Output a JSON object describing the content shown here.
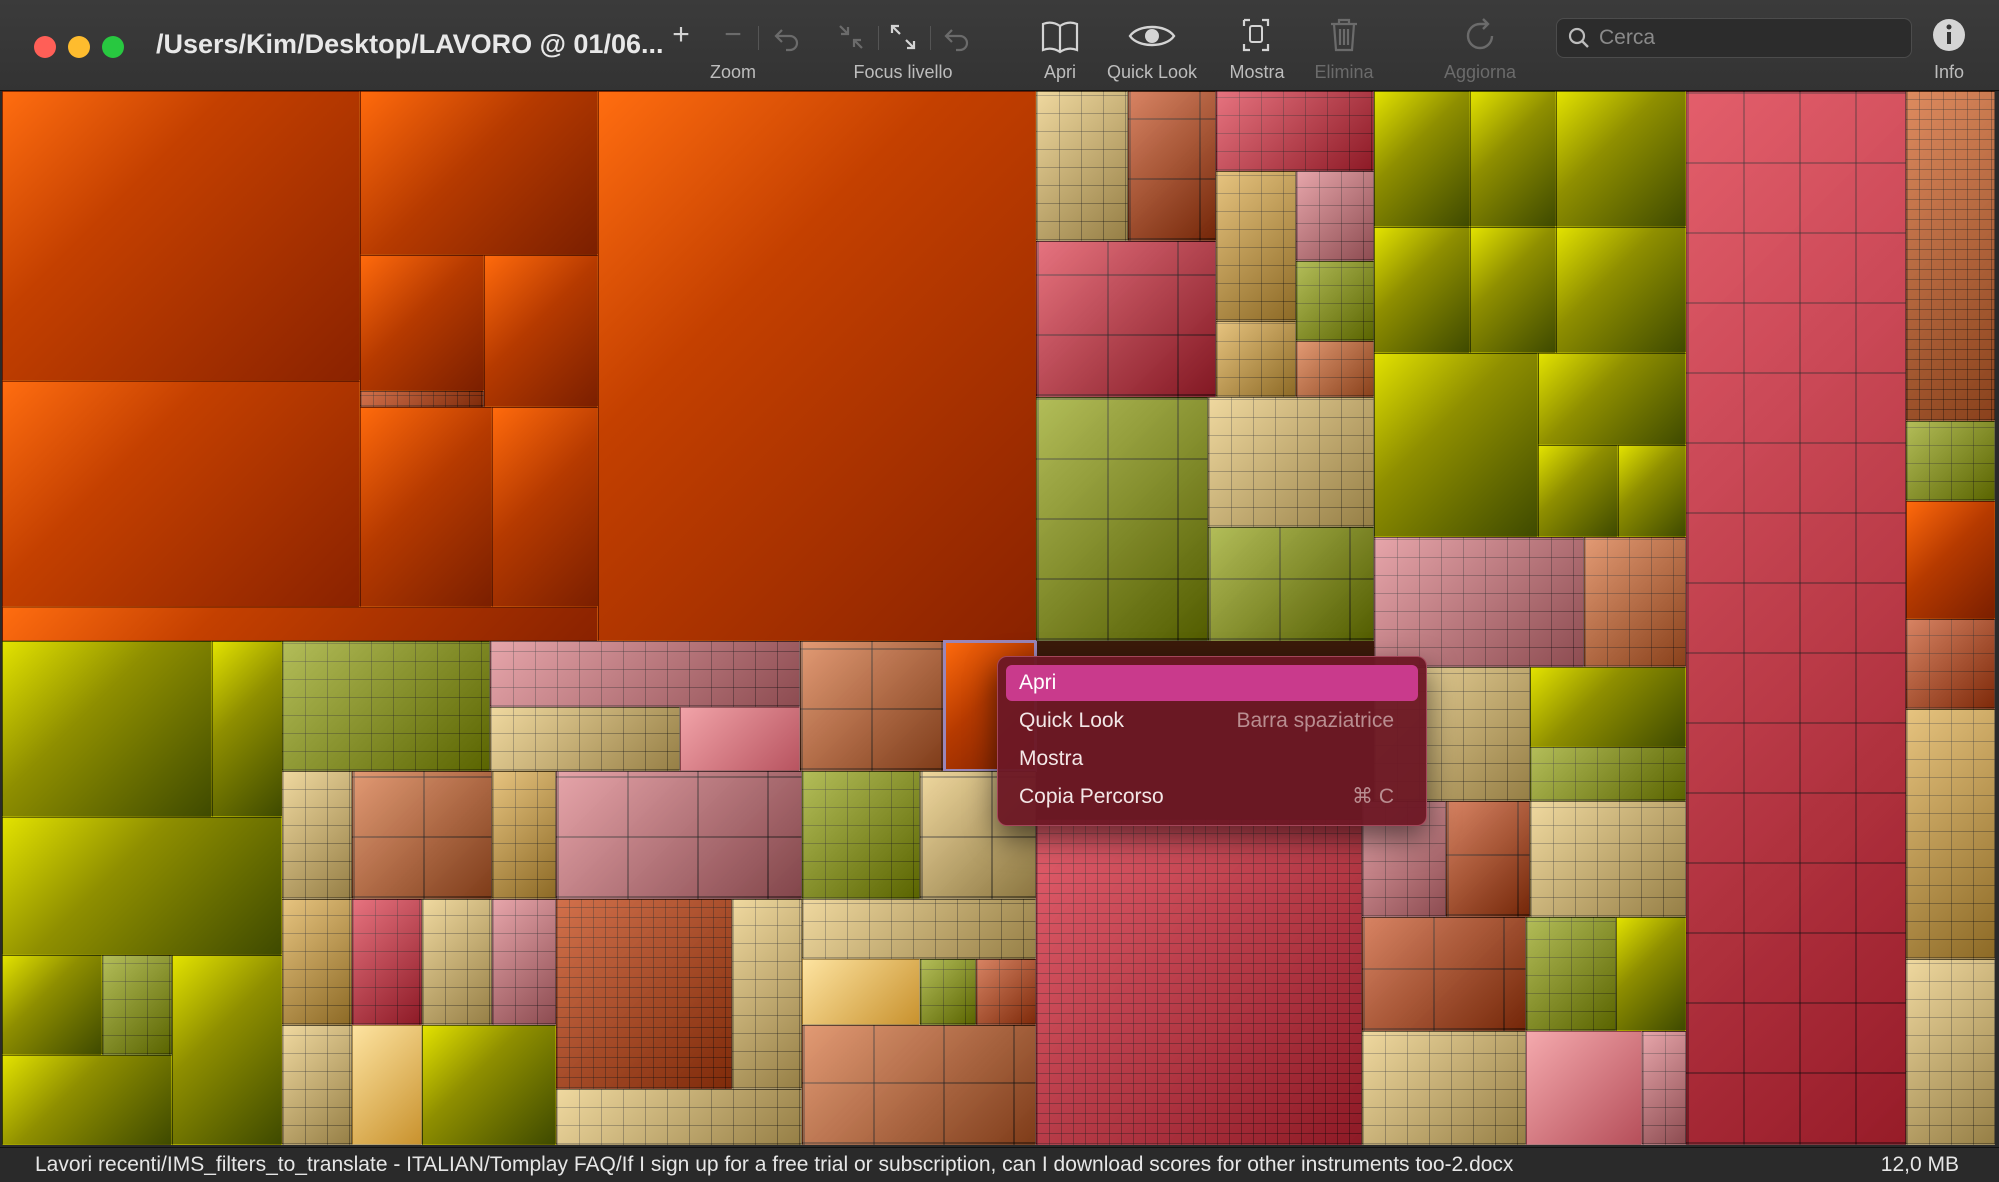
{
  "window": {
    "title": "/Users/Kim/Desktop/LAVORO @ 01/06..."
  },
  "toolbar": {
    "zoom_in_glyph": "+",
    "zoom_out_glyph": "−",
    "zoom_label": "Zoom",
    "focus_label": "Focus livello",
    "open_label": "Apri",
    "quicklook_label": "Quick Look",
    "reveal_label": "Mostra",
    "delete_label": "Elimina",
    "refresh_label": "Aggiorna",
    "info_label": "Info",
    "search_placeholder": "Cerca"
  },
  "icons": {
    "zoom_in": "plus-icon",
    "zoom_out": "minus-icon",
    "back": "undo-icon",
    "collapse": "collapse-arrows-icon",
    "expand": "expand-arrows-icon",
    "open": "book-icon",
    "quicklook": "eye-icon",
    "reveal": "reveal-icon",
    "delete": "trash-icon",
    "refresh": "refresh-icon",
    "search": "search-icon",
    "info": "info-icon"
  },
  "context_menu": {
    "items": [
      {
        "label": "Apri",
        "shortcut": ""
      },
      {
        "label": "Quick Look",
        "shortcut": "Barra spaziatrice"
      },
      {
        "label": "Mostra",
        "shortcut": ""
      },
      {
        "label": "Copia Percorso",
        "shortcut": "⌘ C"
      }
    ]
  },
  "statusbar": {
    "path": "Lavori recenti/IMS_filters_to_translate - ITALIAN/Tomplay FAQ/If I sign up for a free trial or subscription, can I download scores for other instruments too-2.docx",
    "size": "12,0 MB"
  },
  "colors": {
    "menu_selection": "#c93a8c",
    "treemap_orange": "#c44000",
    "treemap_olive": "#8f8f00",
    "treemap_red": "#d9283a",
    "treemap_tan": "#e7c36b"
  }
}
